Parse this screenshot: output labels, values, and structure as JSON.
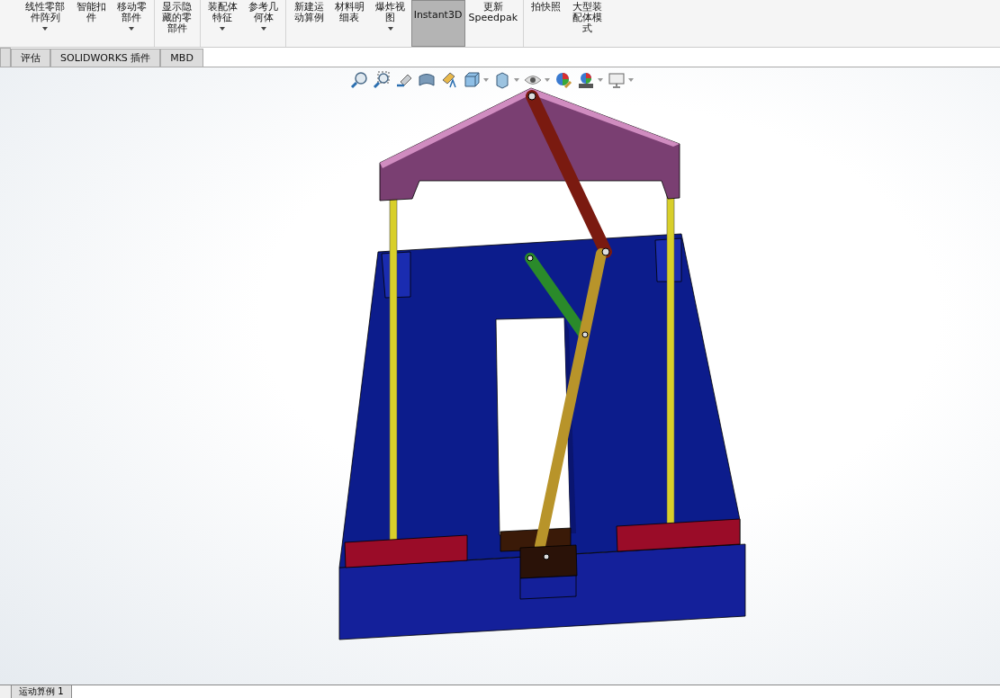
{
  "ribbon": {
    "buttons": [
      {
        "label": "线性零部件阵列",
        "caret": true,
        "selected": false
      },
      {
        "label": "智能扣件",
        "caret": false,
        "selected": false
      },
      {
        "label": "移动零部件",
        "caret": true,
        "selected": false
      },
      {
        "label": "显示隐藏的零部件",
        "caret": false,
        "selected": false
      },
      {
        "label": "装配体特征",
        "caret": true,
        "selected": false
      },
      {
        "label": "参考几何体",
        "caret": true,
        "selected": false
      },
      {
        "label": "新建运动算例",
        "caret": false,
        "selected": false
      },
      {
        "label": "材料明细表",
        "caret": false,
        "selected": false
      },
      {
        "label": "爆炸视图",
        "caret": true,
        "selected": false
      },
      {
        "label": "Instant3D",
        "caret": false,
        "selected": true
      },
      {
        "label": "更新Speedpak",
        "caret": false,
        "selected": false
      },
      {
        "label": "拍快照",
        "caret": false,
        "selected": false
      },
      {
        "label": "大型装配体模式",
        "caret": false,
        "selected": false
      }
    ]
  },
  "command_tabs": [
    {
      "label": "评估",
      "selected": false
    },
    {
      "label": "SOLIDWORKS 插件",
      "selected": false
    },
    {
      "label": "MBD",
      "selected": false
    }
  ],
  "bottom_tabs": [
    {
      "label": "运动算例 1",
      "selected": true
    }
  ]
}
